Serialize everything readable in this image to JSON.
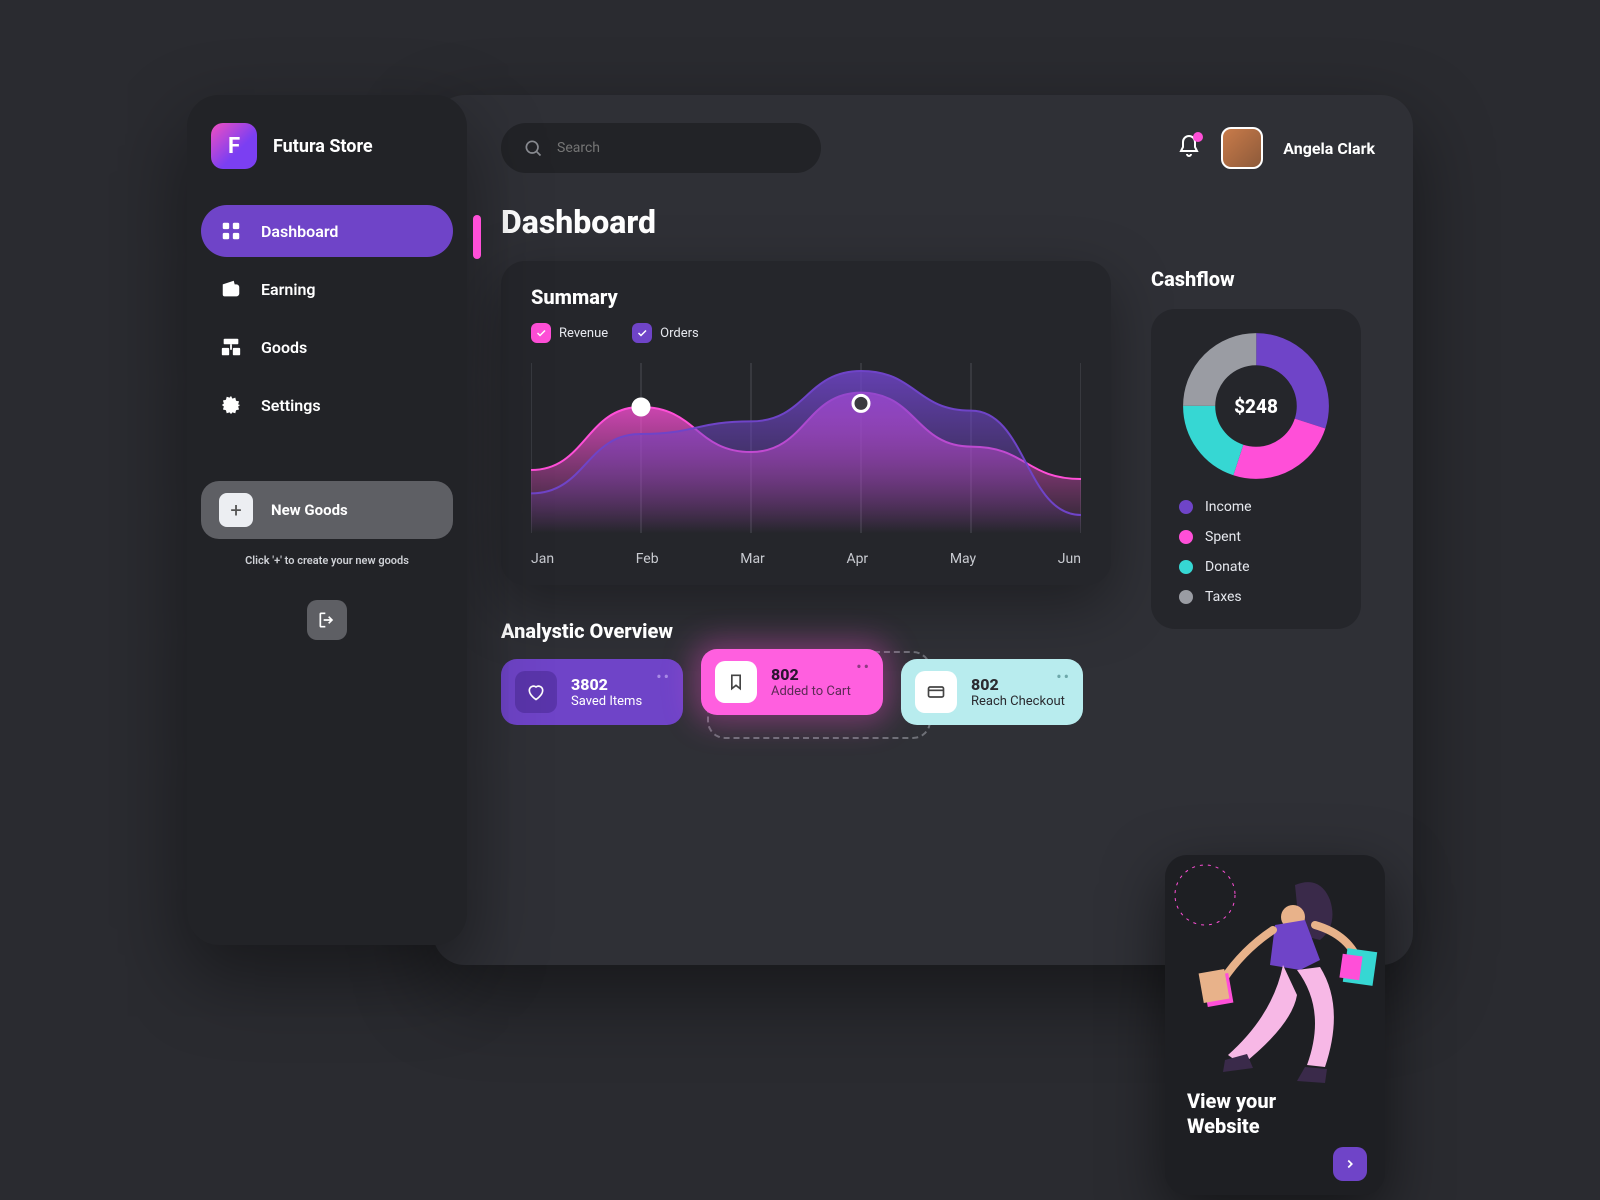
{
  "brand": "Futura Store",
  "logo_letter": "F",
  "sidebar": {
    "items": [
      {
        "label": "Dashboard",
        "icon": "grid",
        "active": true
      },
      {
        "label": "Earning",
        "icon": "wallet",
        "active": false
      },
      {
        "label": "Goods",
        "icon": "boxes",
        "active": false
      },
      {
        "label": "Settings",
        "icon": "gear",
        "active": false
      }
    ],
    "new_goods_label": "New Goods",
    "hint": "Click '+' to create your new goods"
  },
  "search": {
    "placeholder": "Search"
  },
  "user": {
    "name": "Angela Clark",
    "has_notification": true
  },
  "page_title": "Dashboard",
  "summary": {
    "title": "Summary",
    "legend": [
      {
        "label": "Revenue",
        "color": "pink"
      },
      {
        "label": "Orders",
        "color": "purple"
      }
    ]
  },
  "chart_data": {
    "type": "area",
    "categories": [
      "Jan",
      "Feb",
      "Mar",
      "Apr",
      "May",
      "Jun"
    ],
    "series": [
      {
        "name": "Revenue",
        "color": "#ff4fd8",
        "values": [
          35,
          70,
          45,
          78,
          48,
          30
        ]
      },
      {
        "name": "Orders",
        "color": "#6f44c8",
        "values": [
          22,
          55,
          62,
          90,
          68,
          10
        ]
      }
    ],
    "markers": [
      {
        "series": "Revenue",
        "x": "Feb",
        "y": 70
      },
      {
        "series": "Orders",
        "x": "Apr",
        "y": 72
      }
    ],
    "xlabel": "",
    "ylabel": "",
    "ylim": [
      0,
      100
    ]
  },
  "cashflow": {
    "title": "Cashflow",
    "center_value": "$248",
    "segments": [
      {
        "label": "Income",
        "color": "#6f44c8",
        "value": 30
      },
      {
        "label": "Spent",
        "color": "#ff4fd8",
        "value": 25
      },
      {
        "label": "Donate",
        "color": "#36d7d3",
        "value": 20
      },
      {
        "label": "Taxes",
        "color": "#9a9ca3",
        "value": 25
      }
    ]
  },
  "overview": {
    "title": "Analystic Overview",
    "cards": [
      {
        "value": "3802",
        "label": "Saved Items",
        "variant": "purple",
        "icon": "heart"
      },
      {
        "value": "802",
        "label": "Added to Cart",
        "variant": "pink",
        "icon": "bookmark"
      },
      {
        "value": "802",
        "label": "Reach Checkout",
        "variant": "teal",
        "icon": "card"
      }
    ]
  },
  "promo": {
    "line1": "View your",
    "line2": "Website"
  },
  "colors": {
    "purple": "#6f44c8",
    "pink": "#ff4fd8",
    "teal": "#36d7d3",
    "grey": "#9a9ca3"
  }
}
